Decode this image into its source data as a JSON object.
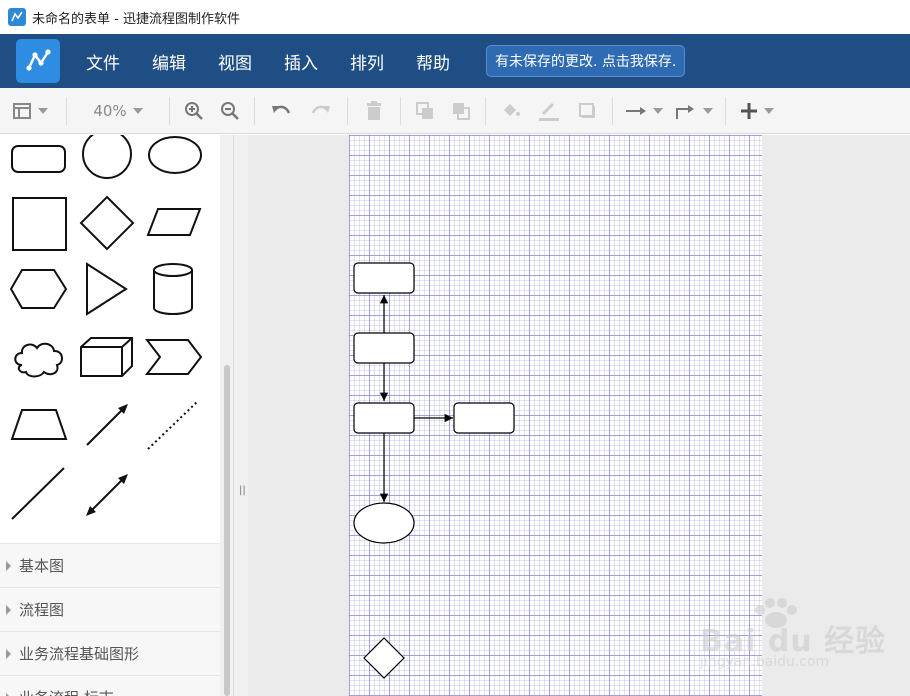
{
  "window": {
    "title": "未命名的表单 - 迅捷流程图制作软件"
  },
  "menubar": {
    "items": [
      "文件",
      "编辑",
      "视图",
      "插入",
      "排列",
      "帮助"
    ],
    "save_notice": "有未保存的更改. 点击我保存."
  },
  "toolbar": {
    "zoom": "40%",
    "buttons": [
      "page-layout",
      "zoom-in",
      "zoom-out",
      "undo",
      "redo",
      "delete",
      "to-front",
      "to-back",
      "fill-color",
      "line-color",
      "shadow",
      "connector-style",
      "waypoints",
      "insert"
    ]
  },
  "sidebar": {
    "shapes": [
      "rounded-rectangle",
      "circle",
      "ellipse",
      "square",
      "diamond",
      "parallelogram",
      "hexagon",
      "triangle",
      "cylinder",
      "cloud",
      "cube",
      "step",
      "trapezoid",
      "arrow",
      "dotted-line",
      "line",
      "bidirectional-arrow"
    ],
    "sections": [
      "基本图",
      "流程图",
      "业务流程基础图形",
      "业务流程 标志"
    ]
  },
  "watermark": {
    "brand": "Bai du 经验",
    "url": "jingyan.baidu.com"
  },
  "colors": {
    "menubar_bg": "#1f4e84",
    "accent": "#2e8de3",
    "grid_line": "#6e6ed2"
  }
}
